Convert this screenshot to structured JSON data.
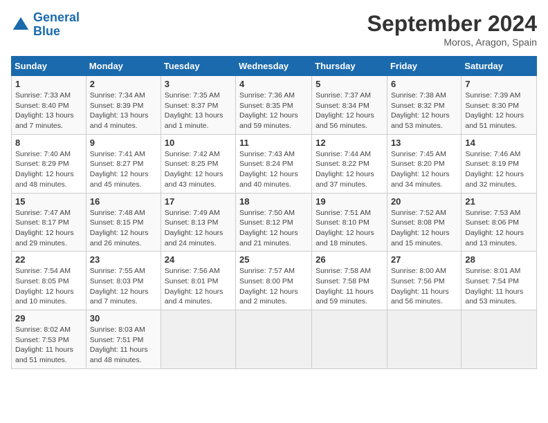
{
  "header": {
    "logo_line1": "General",
    "logo_line2": "Blue",
    "month": "September 2024",
    "location": "Moros, Aragon, Spain"
  },
  "days_of_week": [
    "Sunday",
    "Monday",
    "Tuesday",
    "Wednesday",
    "Thursday",
    "Friday",
    "Saturday"
  ],
  "weeks": [
    [
      {
        "num": "1",
        "sunrise": "7:33 AM",
        "sunset": "8:40 PM",
        "daylight": "13 hours and 7 minutes."
      },
      {
        "num": "2",
        "sunrise": "7:34 AM",
        "sunset": "8:39 PM",
        "daylight": "13 hours and 4 minutes."
      },
      {
        "num": "3",
        "sunrise": "7:35 AM",
        "sunset": "8:37 PM",
        "daylight": "13 hours and 1 minute."
      },
      {
        "num": "4",
        "sunrise": "7:36 AM",
        "sunset": "8:35 PM",
        "daylight": "12 hours and 59 minutes."
      },
      {
        "num": "5",
        "sunrise": "7:37 AM",
        "sunset": "8:34 PM",
        "daylight": "12 hours and 56 minutes."
      },
      {
        "num": "6",
        "sunrise": "7:38 AM",
        "sunset": "8:32 PM",
        "daylight": "12 hours and 53 minutes."
      },
      {
        "num": "7",
        "sunrise": "7:39 AM",
        "sunset": "8:30 PM",
        "daylight": "12 hours and 51 minutes."
      }
    ],
    [
      {
        "num": "8",
        "sunrise": "7:40 AM",
        "sunset": "8:29 PM",
        "daylight": "12 hours and 48 minutes."
      },
      {
        "num": "9",
        "sunrise": "7:41 AM",
        "sunset": "8:27 PM",
        "daylight": "12 hours and 45 minutes."
      },
      {
        "num": "10",
        "sunrise": "7:42 AM",
        "sunset": "8:25 PM",
        "daylight": "12 hours and 43 minutes."
      },
      {
        "num": "11",
        "sunrise": "7:43 AM",
        "sunset": "8:24 PM",
        "daylight": "12 hours and 40 minutes."
      },
      {
        "num": "12",
        "sunrise": "7:44 AM",
        "sunset": "8:22 PM",
        "daylight": "12 hours and 37 minutes."
      },
      {
        "num": "13",
        "sunrise": "7:45 AM",
        "sunset": "8:20 PM",
        "daylight": "12 hours and 34 minutes."
      },
      {
        "num": "14",
        "sunrise": "7:46 AM",
        "sunset": "8:19 PM",
        "daylight": "12 hours and 32 minutes."
      }
    ],
    [
      {
        "num": "15",
        "sunrise": "7:47 AM",
        "sunset": "8:17 PM",
        "daylight": "12 hours and 29 minutes."
      },
      {
        "num": "16",
        "sunrise": "7:48 AM",
        "sunset": "8:15 PM",
        "daylight": "12 hours and 26 minutes."
      },
      {
        "num": "17",
        "sunrise": "7:49 AM",
        "sunset": "8:13 PM",
        "daylight": "12 hours and 24 minutes."
      },
      {
        "num": "18",
        "sunrise": "7:50 AM",
        "sunset": "8:12 PM",
        "daylight": "12 hours and 21 minutes."
      },
      {
        "num": "19",
        "sunrise": "7:51 AM",
        "sunset": "8:10 PM",
        "daylight": "12 hours and 18 minutes."
      },
      {
        "num": "20",
        "sunrise": "7:52 AM",
        "sunset": "8:08 PM",
        "daylight": "12 hours and 15 minutes."
      },
      {
        "num": "21",
        "sunrise": "7:53 AM",
        "sunset": "8:06 PM",
        "daylight": "12 hours and 13 minutes."
      }
    ],
    [
      {
        "num": "22",
        "sunrise": "7:54 AM",
        "sunset": "8:05 PM",
        "daylight": "12 hours and 10 minutes."
      },
      {
        "num": "23",
        "sunrise": "7:55 AM",
        "sunset": "8:03 PM",
        "daylight": "12 hours and 7 minutes."
      },
      {
        "num": "24",
        "sunrise": "7:56 AM",
        "sunset": "8:01 PM",
        "daylight": "12 hours and 4 minutes."
      },
      {
        "num": "25",
        "sunrise": "7:57 AM",
        "sunset": "8:00 PM",
        "daylight": "12 hours and 2 minutes."
      },
      {
        "num": "26",
        "sunrise": "7:58 AM",
        "sunset": "7:58 PM",
        "daylight": "11 hours and 59 minutes."
      },
      {
        "num": "27",
        "sunrise": "8:00 AM",
        "sunset": "7:56 PM",
        "daylight": "11 hours and 56 minutes."
      },
      {
        "num": "28",
        "sunrise": "8:01 AM",
        "sunset": "7:54 PM",
        "daylight": "11 hours and 53 minutes."
      }
    ],
    [
      {
        "num": "29",
        "sunrise": "8:02 AM",
        "sunset": "7:53 PM",
        "daylight": "11 hours and 51 minutes."
      },
      {
        "num": "30",
        "sunrise": "8:03 AM",
        "sunset": "7:51 PM",
        "daylight": "11 hours and 48 minutes."
      },
      null,
      null,
      null,
      null,
      null
    ]
  ]
}
